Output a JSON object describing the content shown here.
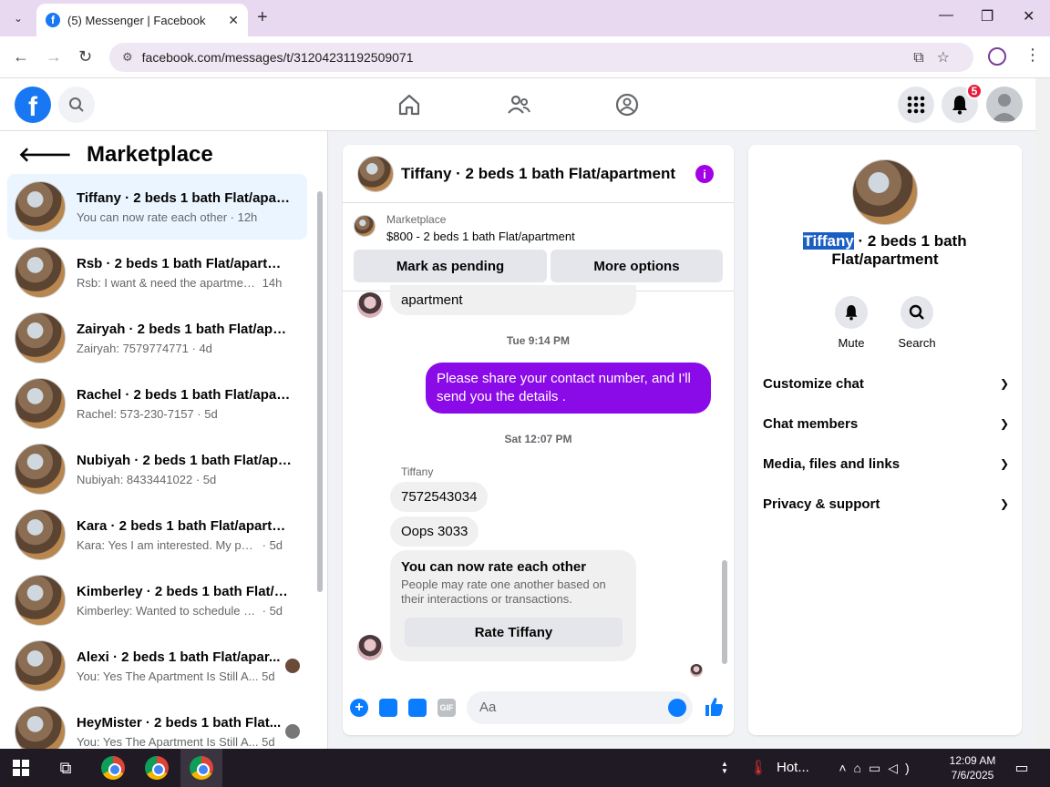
{
  "browser": {
    "tab_title": "(5) Messenger | Facebook",
    "url": "facebook.com/messages/t/31204231192509071"
  },
  "fb_header": {
    "notification_count": "5"
  },
  "left_panel": {
    "title": "Marketplace",
    "conversations": [
      {
        "name": "Tiffany · 2 beds 1 bath Flat/apart...",
        "preview": "You can now rate each other",
        "time": "· 12h"
      },
      {
        "name": "Rsb · 2 beds 1 bath Flat/apartme...",
        "preview": "Rsb: I want & need the apartment....",
        "time": "14h"
      },
      {
        "name": "Zairyah · 2 beds 1 bath Flat/apar...",
        "preview": "Zairyah: 7579774771",
        "time": "· 4d"
      },
      {
        "name": "Rachel · 2 beds 1 bath Flat/apart...",
        "preview": "Rachel: 573-230-7157",
        "time": "· 5d"
      },
      {
        "name": "Nubiyah · 2 beds 1 bath Flat/apa...",
        "preview": "Nubiyah: 8433441022",
        "time": "· 5d"
      },
      {
        "name": "Kara · 2 beds 1 bath Flat/apartm...",
        "preview": "Kara: Yes I am interested. My phon...",
        "time": "· 5d"
      },
      {
        "name": "Kimberley · 2 beds 1 bath Flat/a...",
        "preview": "Kimberley: Wanted to schedule a t...",
        "time": "· 5d"
      },
      {
        "name": "Alexi · 2 beds 1 bath Flat/apar...",
        "preview": "You: Yes The Apartment Is Still A...",
        "time": "5d"
      },
      {
        "name": "HeyMister · 2 beds 1 bath Flat...",
        "preview": "You: Yes The Apartment Is Still A...",
        "time": "5d"
      }
    ]
  },
  "chat": {
    "title": "Tiffany · 2 beds 1 bath Flat/apartment",
    "marketplace_label": "Marketplace",
    "listing": "$800 - 2 beds 1 bath Flat/apartment",
    "mark_pending": "Mark as pending",
    "more_options": "More options",
    "partial_message": "apartment",
    "ts1": "Tue 9:14 PM",
    "outgoing": "Please share your contact number, and I'll send you the details .",
    "ts2": "Sat 12:07 PM",
    "sender": "Tiffany",
    "msg1": "7572543034",
    "msg2": "Oops 3033",
    "rate_title": "You can now rate each other",
    "rate_desc": "People may rate one another based on their interactions or transactions.",
    "rate_button": "Rate Tiffany",
    "composer_placeholder": "Aa"
  },
  "right_panel": {
    "name_highlight": "Tiffany",
    "name_rest": " · 2 beds 1 bath Flat/apartment",
    "mute": "Mute",
    "search": "Search",
    "sections": [
      "Customize chat",
      "Chat members",
      "Media, files and links",
      "Privacy & support"
    ]
  },
  "taskbar": {
    "weather": "Hot...",
    "time": "12:09 AM",
    "date": "7/6/2025"
  }
}
